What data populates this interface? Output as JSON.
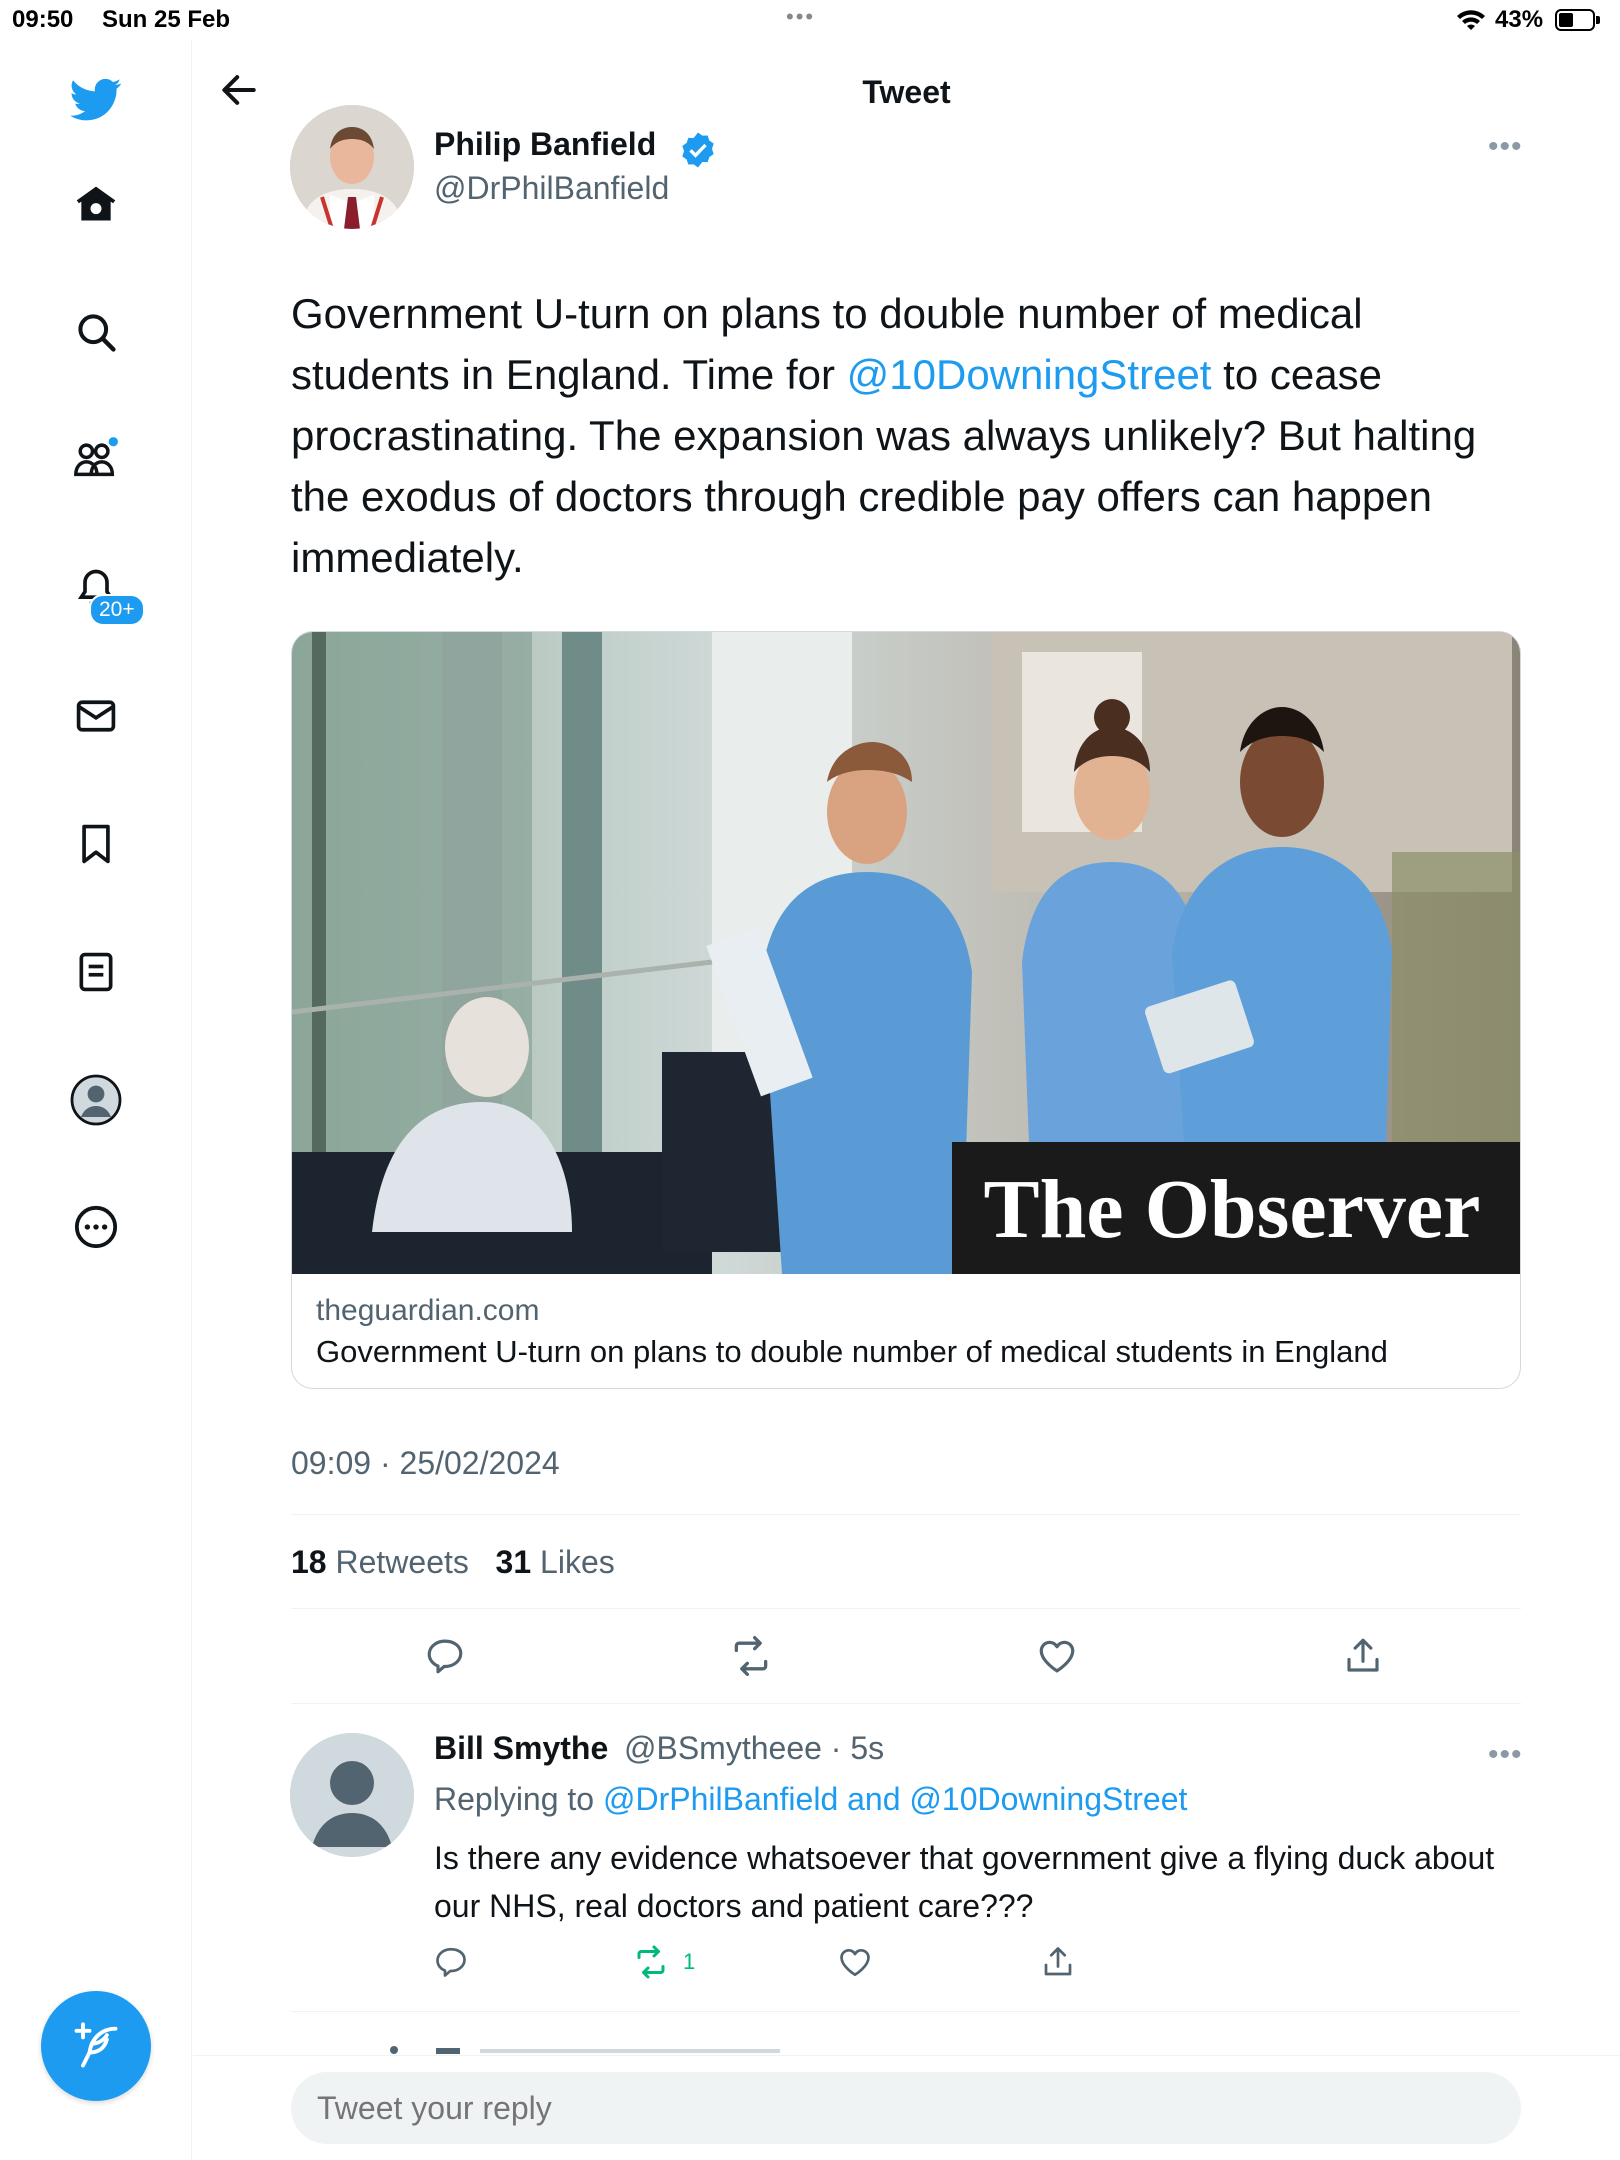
{
  "status_bar": {
    "time": "09:50",
    "date": "Sun 25 Feb",
    "battery": "43%"
  },
  "nav": {
    "notification_badge": "20+"
  },
  "header": {
    "title": "Tweet"
  },
  "tweet": {
    "author_name": "Philip Banfield",
    "author_handle": "@DrPhilBanfield",
    "text_before": "Government U-turn on plans to double number of medical students in England. Time for ",
    "mention": "@10DowningStreet",
    "text_after": " to cease procrastinating. The expansion was always unlikely? But halting the exodus of doctors through credible pay offers can happen immediately.",
    "card": {
      "image_caption": "The Observer",
      "domain": "theguardian.com",
      "title": "Government U-turn on plans to double number of medical students in England"
    },
    "timestamp": "09:09 · 25/02/2024",
    "retweets_count": "18",
    "retweets_label": "Retweets",
    "likes_count": "31",
    "likes_label": "Likes"
  },
  "reply": {
    "author_name": "Bill Smythe",
    "meta": "@BSmytheee · 5s",
    "replying_prefix": "Replying to ",
    "replying_to": "@DrPhilBanfield and @10DowningStreet",
    "text": "Is there any evidence whatsoever that government give a flying duck about our NHS, real doctors and patient care???",
    "retweet_count": "1"
  },
  "composer": {
    "placeholder": "Tweet your reply"
  },
  "colors": {
    "accent": "#1d9bf0",
    "retweet_green": "#00ba7c",
    "secondary_text": "#536471"
  }
}
